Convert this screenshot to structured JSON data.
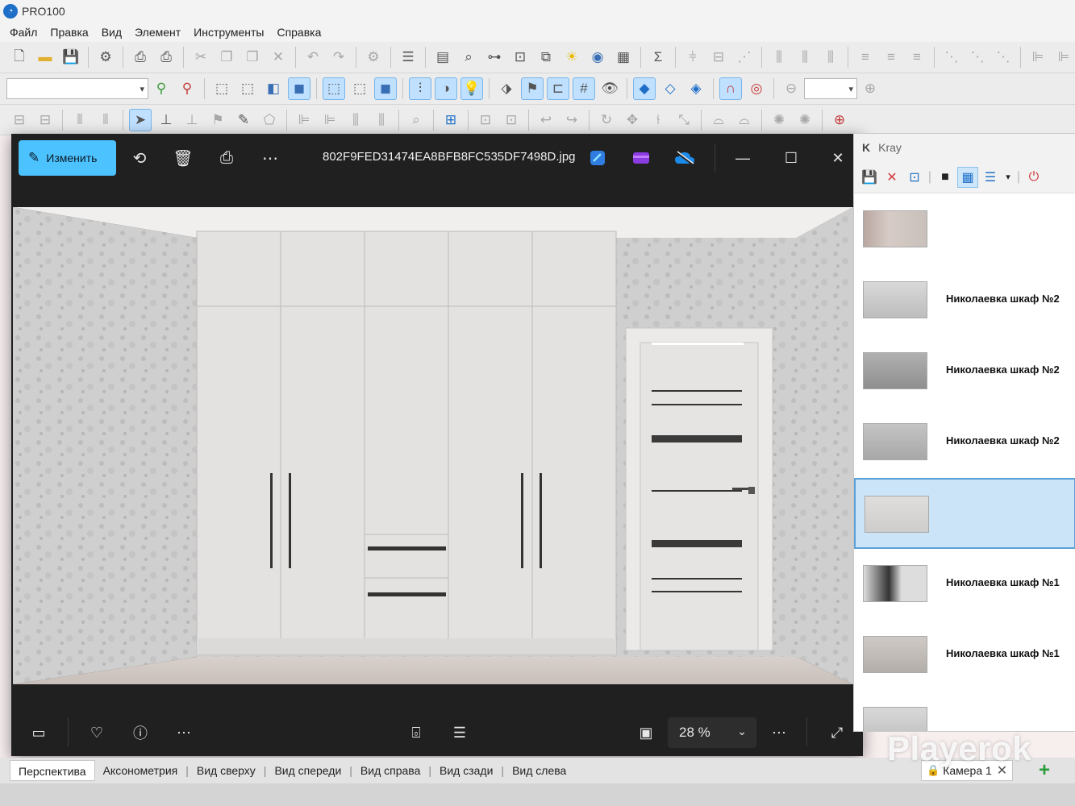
{
  "app": {
    "title": "PRO100"
  },
  "menu": [
    "Файл",
    "Правка",
    "Вид",
    "Элемент",
    "Инструменты",
    "Справка"
  ],
  "toolbar2": {
    "zoom_value": ""
  },
  "viewer": {
    "edit_label": "Изменить",
    "filename": "802F9FED31474EA8BFB8FC535DF7498D.jpg",
    "zoom": "28 %"
  },
  "kray": {
    "title": "Kray",
    "items": [
      {
        "label": ""
      },
      {
        "label": "Николаевка шкаф №2"
      },
      {
        "label": "Николаевка шкаф №2"
      },
      {
        "label": "Николаевка шкаф №2"
      },
      {
        "label": ""
      },
      {
        "label": "Николаевка шкаф №1"
      },
      {
        "label": "Николаевка шкаф №1"
      },
      {
        "label": ""
      }
    ]
  },
  "tabs": [
    "Перспектива",
    "Аксонометрия",
    "Вид сверху",
    "Вид спереди",
    "Вид справа",
    "Вид сзади",
    "Вид слева"
  ],
  "camera_tab": "Камера 1",
  "watermark": "Playerok",
  "colors": {
    "accent": "#4cc2ff",
    "selection": "#cce4f7",
    "viewer_bg": "#202020"
  }
}
